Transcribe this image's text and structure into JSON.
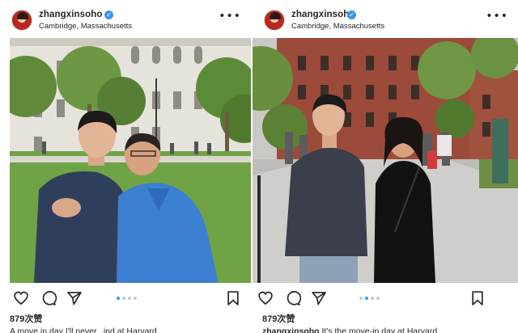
{
  "posts": [
    {
      "username": "zhangxinsoho",
      "location": "Cambridge, Massachusetts",
      "likes": "879次赞",
      "caption_user": "",
      "caption_text": "A move in day I'll never...ind at Harvard",
      "carousel": {
        "count": 4,
        "active_index": 0
      }
    },
    {
      "username": "zhangxinsoho",
      "location": "Cambridge, Massachusetts",
      "likes": "879次赞",
      "caption_user": "zhangxinsoho",
      "caption_text": " It's the move-in day at Harvard",
      "carousel": {
        "count": 4,
        "active_index": 1
      }
    }
  ],
  "icons": {
    "verified": "verified-badge-icon",
    "more": "more-options-icon",
    "like": "heart-icon",
    "comment": "comment-icon",
    "share": "send-icon",
    "save": "bookmark-icon"
  },
  "colors": {
    "verified": "#3897f0",
    "active_dot": "#3897f0",
    "text": "#262626"
  },
  "glyphs": {
    "verified": "✓",
    "more": "•••"
  }
}
